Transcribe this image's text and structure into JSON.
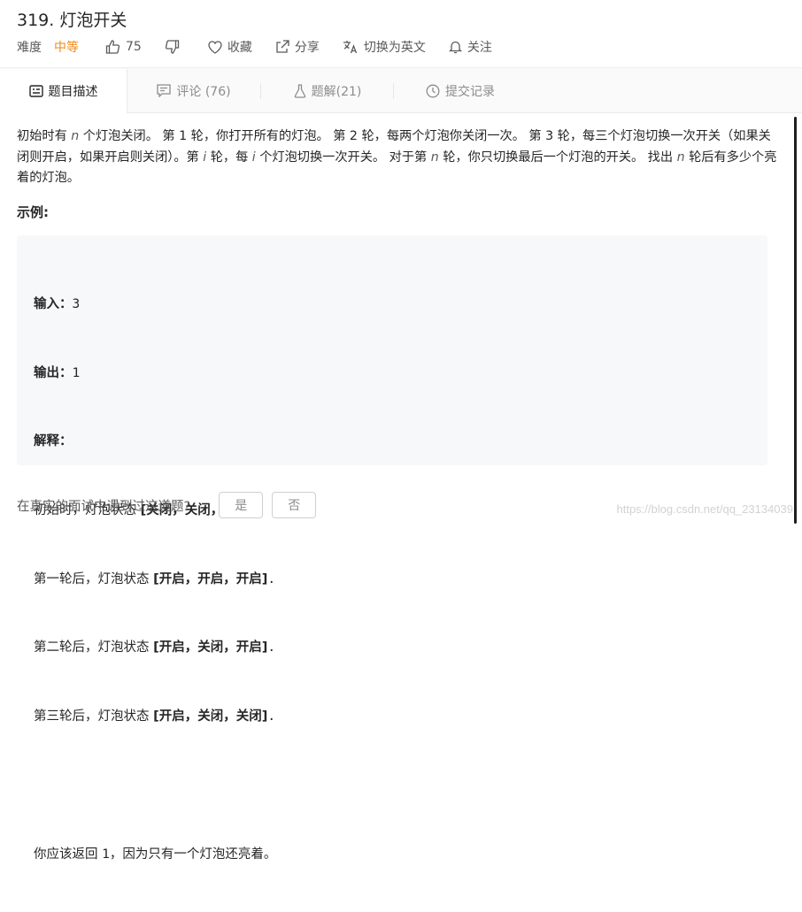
{
  "title": "319. 灯泡开关",
  "meta": {
    "difficulty_label": "难度",
    "difficulty_value": "中等",
    "likes": "75",
    "collect": "收藏",
    "share": "分享",
    "switch_lang": "切换为英文",
    "follow": "关注"
  },
  "tabs": [
    {
      "label": "题目描述",
      "icon": "description-icon"
    },
    {
      "label": "评论 (76)",
      "icon": "comment-icon"
    },
    {
      "label": "题解(21)",
      "icon": "flask-icon"
    },
    {
      "label": "提交记录",
      "icon": "clock-icon"
    }
  ],
  "description": {
    "s1": "初始时有 ",
    "n1": "n",
    "s2": " 个灯泡关闭。 第 1 轮，你打开所有的灯泡。 第 2 轮，每两个灯泡你关闭一次。 第 3 轮，每三个灯泡切换一次开关（如果关闭则开启，如果开启则关闭）。第 ",
    "i1": "i",
    "s3": " 轮，每 ",
    "i2": "i",
    "s4": " 个灯泡切换一次开关。 对于第 ",
    "n2": "n",
    "s5": " 轮，你只切换最后一个灯泡的开关。 找出 ",
    "n3": "n",
    "s6": " 轮后有多少个亮着的灯泡。"
  },
  "example": {
    "heading": "示例:",
    "input_label": "输入：",
    "input_value": "3",
    "output_label": "输出：",
    "output_value": "1",
    "explain_label": "解释：",
    "lines": [
      {
        "text": "初始时，灯泡状态 ",
        "state": "[关闭，关闭，关闭]",
        "end": "."
      },
      {
        "text": "第一轮后，灯泡状态 ",
        "state": "[开启，开启，开启]",
        "end": "."
      },
      {
        "text": "第二轮后，灯泡状态 ",
        "state": "[开启，关闭，开启]",
        "end": "."
      },
      {
        "text": "第三轮后，灯泡状态 ",
        "state": "[开启，关闭，关闭]",
        "end": "."
      }
    ],
    "conclusion_a": "你应该返回 ",
    "conclusion_num": "1",
    "conclusion_b": "，因为只有一个灯泡还亮着。"
  },
  "footer": {
    "question": "在真实的面试中遇到过这道题?",
    "yes": "是",
    "no": "否"
  },
  "watermark": "https://blog.csdn.net/qq_23134039",
  "colors": {
    "difficulty": "#ef8a1a",
    "text": "#262626",
    "muted": "#8c8c8c",
    "code_bg": "#f7f8fa"
  }
}
